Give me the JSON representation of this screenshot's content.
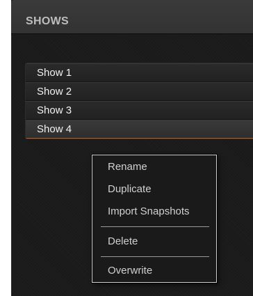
{
  "panel": {
    "title": "SHOWS"
  },
  "shows": [
    {
      "label": "Show 1",
      "selected": false
    },
    {
      "label": "Show 2",
      "selected": false
    },
    {
      "label": "Show 3",
      "selected": false
    },
    {
      "label": "Show 4",
      "selected": true
    }
  ],
  "context_menu": {
    "items": [
      {
        "label": "Rename"
      },
      {
        "label": "Duplicate"
      },
      {
        "label": "Import Snapshots"
      },
      {
        "label": "Delete"
      },
      {
        "label": "Overwrite"
      }
    ]
  },
  "colors": {
    "accent": "#c55a1a",
    "panel_bg": "#1a1a1a",
    "menu_border": "#cfcfcf"
  }
}
